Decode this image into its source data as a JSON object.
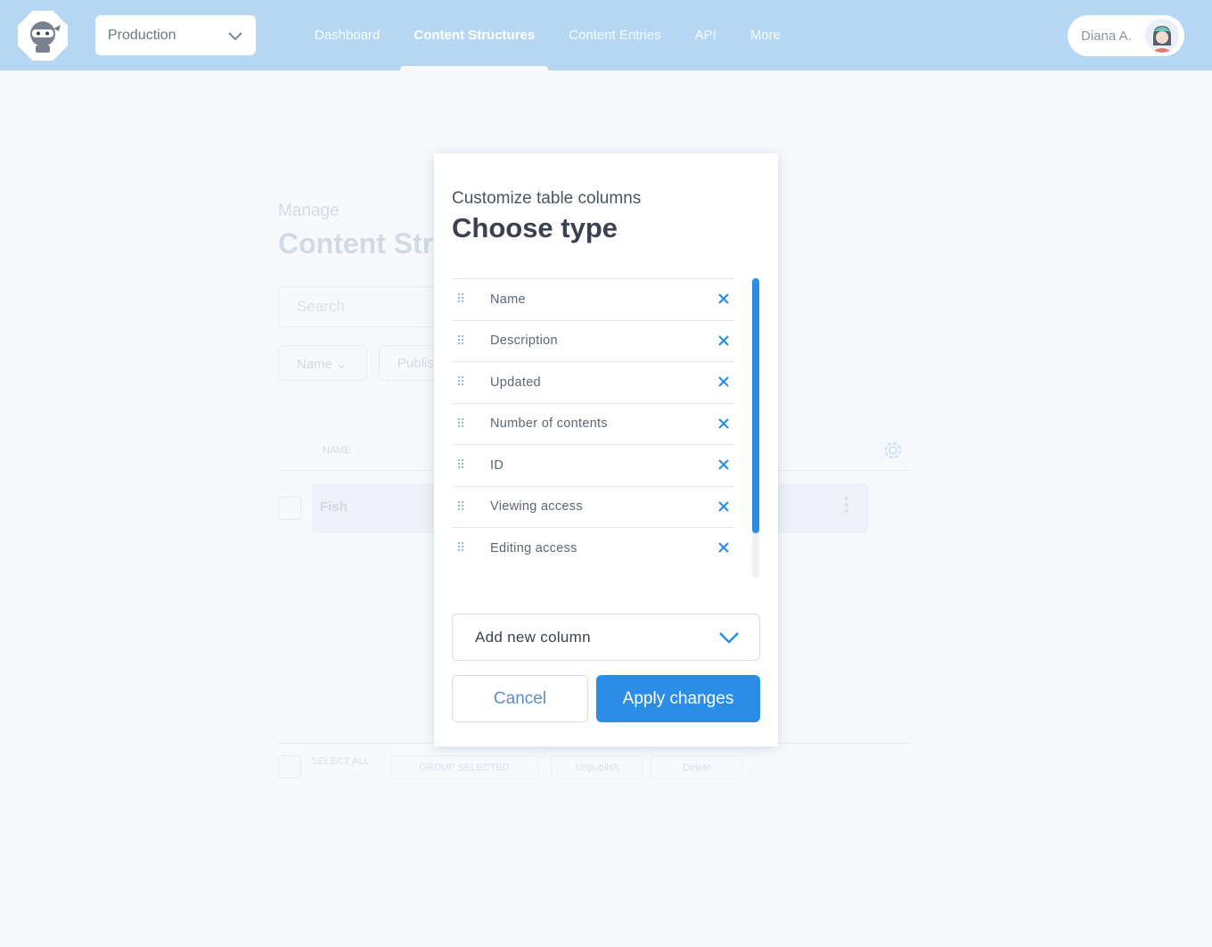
{
  "header": {
    "environment": "Production",
    "nav": [
      "Dashboard",
      "Content Structures",
      "Content Entries",
      "API",
      "More"
    ],
    "active_nav": "Content Structures",
    "user_name": "Diana A."
  },
  "background": {
    "manage_label": "Manage",
    "page_title": "Content Structures",
    "search_placeholder": "Search",
    "filter_name": "Name",
    "filter_published": "Published",
    "column_name": "NAME",
    "row_name": "Fish",
    "footer": {
      "select_all": "SELECT ALL",
      "group_selected": "GROUP SELECTED",
      "unpublish": "Unpublish",
      "delete": "Delete"
    }
  },
  "modal": {
    "subtitle": "Customize table columns",
    "title": "Choose type",
    "columns": [
      "Name",
      "Description",
      "Updated",
      "Number of contents",
      "ID",
      "Viewing access",
      "Editing access"
    ],
    "add_column_label": "Add new column",
    "cancel_label": "Cancel",
    "apply_label": "Apply changes"
  },
  "colors": {
    "header_bg": "#b5d7f4",
    "accent": "#2b8de6"
  }
}
